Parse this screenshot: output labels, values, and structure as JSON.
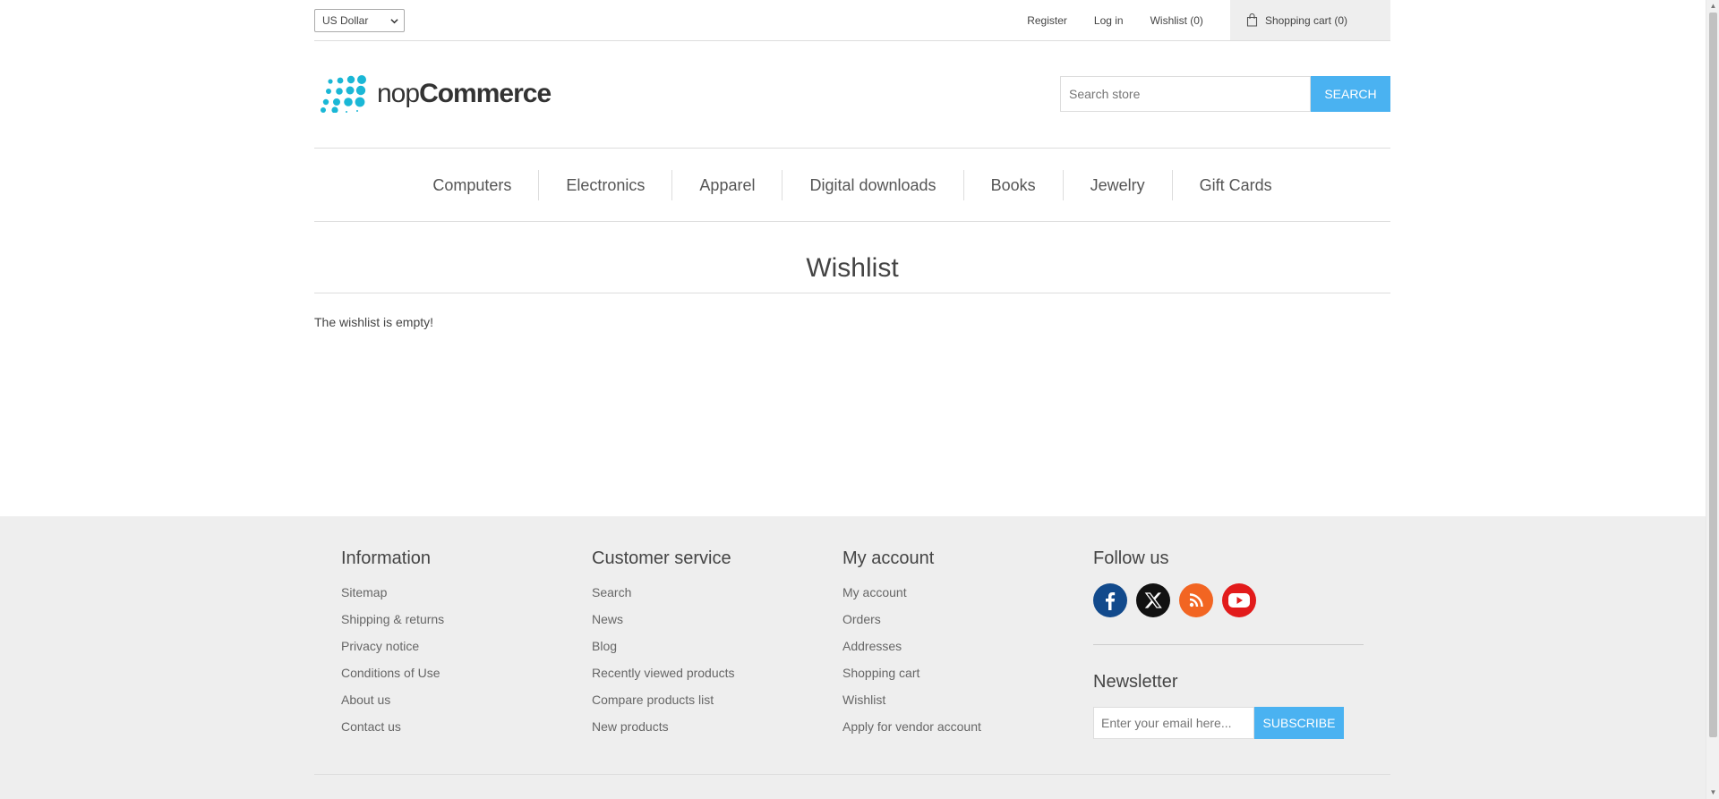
{
  "header": {
    "currency": "US Dollar",
    "links": {
      "register": "Register",
      "login": "Log in",
      "wishlist": "Wishlist (0)",
      "cart": "Shopping cart (0)"
    }
  },
  "logo": {
    "prefix": "nop",
    "brand": "Commerce"
  },
  "search": {
    "placeholder": "Search store",
    "button": "SEARCH"
  },
  "menu": [
    "Computers",
    "Electronics",
    "Apparel",
    "Digital downloads",
    "Books",
    "Jewelry",
    "Gift Cards"
  ],
  "page": {
    "title": "Wishlist",
    "message": "The wishlist is empty!"
  },
  "footer": {
    "information": {
      "title": "Information",
      "items": [
        "Sitemap",
        "Shipping & returns",
        "Privacy notice",
        "Conditions of Use",
        "About us",
        "Contact us"
      ]
    },
    "customer_service": {
      "title": "Customer service",
      "items": [
        "Search",
        "News",
        "Blog",
        "Recently viewed products",
        "Compare products list",
        "New products"
      ]
    },
    "my_account": {
      "title": "My account",
      "items": [
        "My account",
        "Orders",
        "Addresses",
        "Shopping cart",
        "Wishlist",
        "Apply for vendor account"
      ]
    },
    "follow_us": {
      "title": "Follow us"
    },
    "newsletter": {
      "title": "Newsletter",
      "placeholder": "Enter your email here...",
      "button": "SUBSCRIBE"
    }
  },
  "colors": {
    "accent": "#4ab2f1",
    "logo_dots": "#1ab7d6",
    "facebook": "#124a8c",
    "x": "#111111",
    "rss": "#f26522",
    "youtube": "#e21b1b"
  }
}
